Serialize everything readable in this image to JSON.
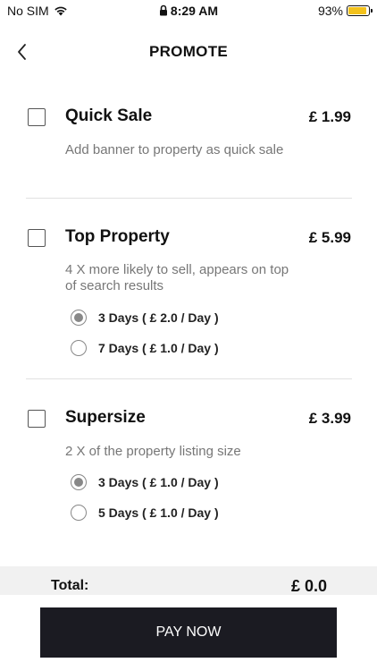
{
  "status_bar": {
    "carrier": "No SIM",
    "time": "8:29 AM",
    "battery": "93%",
    "battery_level": 0.93,
    "battery_color": "#f3c21c"
  },
  "nav": {
    "title": "PROMOTE"
  },
  "options": [
    {
      "title": "Quick Sale",
      "price": "£ 1.99",
      "description": "Add banner to property as quick sale",
      "checked": false
    },
    {
      "title": "Top Property",
      "price": "£ 5.99",
      "description": "4 X more likely to sell, appears on top of search results",
      "checked": false,
      "durations": [
        {
          "label": "3 Days ( £ 2.0 / Day )",
          "selected": true
        },
        {
          "label": "7 Days ( £ 1.0 / Day )",
          "selected": false
        }
      ]
    },
    {
      "title": "Supersize",
      "price": "£ 3.99",
      "description": "2 X of the property listing size",
      "checked": false,
      "durations": [
        {
          "label": "3 Days ( £ 1.0 / Day )",
          "selected": true
        },
        {
          "label": "5 Days ( £ 1.0 / Day )",
          "selected": false
        }
      ]
    }
  ],
  "total": {
    "label": "Total:",
    "value": "£ 0.0"
  },
  "pay_button": {
    "label": "PAY NOW",
    "color": "#1b1b22"
  }
}
